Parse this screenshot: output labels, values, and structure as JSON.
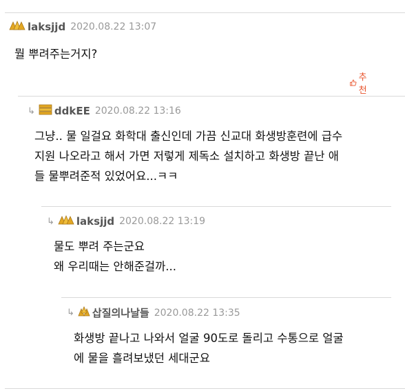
{
  "comments": [
    {
      "nickname": "laksjjd",
      "date": "2020.08.22 13:07",
      "badge_icon": "gold-rank-icon",
      "lines": [
        "뭘 뿌려주는거지?"
      ],
      "recommend_label": "추천"
    },
    {
      "nickname": "ddkEE",
      "date": "2020.08.22 13:16",
      "badge_icon": "gold-bars-icon",
      "lines": [
        "그냥.. 물 일걸요 화학대 출신인데 가끔 신교대 화생방훈련에 급수",
        "지원 나오라고 해서 가면 저렇게 제독소 설치하고 화생방 끝난 애",
        "들 물뿌려준적 있었어요...ㅋㅋ"
      ]
    },
    {
      "nickname": "laksjjd",
      "date": "2020.08.22 13:19",
      "badge_icon": "gold-rank-icon",
      "lines": [
        "물도 뿌려 주는군요",
        "왜 우리때는 안해준걸까..."
      ]
    },
    {
      "nickname": "삽질의나날들",
      "date": "2020.08.22 13:35",
      "badge_icon": "gold-rank-icon",
      "lines": [
        "화생방 끝나고 나와서 얼굴 90도로 돌리고 수통으로 얼굴",
        "에 물을 흘려보냈던 세대군요"
      ]
    }
  ],
  "colors": {
    "accent": "#e8532b",
    "badge_gold": "#e3a824",
    "divider": "#d9d9d9",
    "meta_gray": "#999999"
  }
}
